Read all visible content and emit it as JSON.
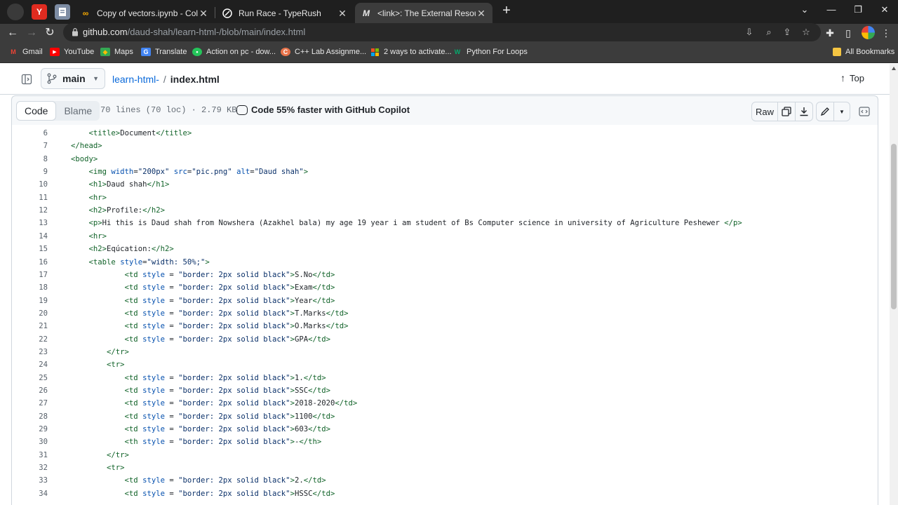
{
  "browser": {
    "pinned_tabs": [
      {
        "icon": "yandex-icon",
        "letter": "Y",
        "color": "#e02b20"
      },
      {
        "icon": "document-icon",
        "letter": "",
        "color": "#7d8ca3"
      }
    ],
    "tabs": [
      {
        "title": "Copy of vectors.ipynb - Colabora",
        "icon": "colab-icon",
        "active": false
      },
      {
        "title": "Run Race - TypeRush",
        "icon": "typerush-icon",
        "active": false
      },
      {
        "title": "<link>: The External Resource Lin",
        "icon": "mdn-icon",
        "active": true
      }
    ],
    "url_host": "github.com",
    "url_path": "/daud-shah/learn-html-/blob/main/index.html",
    "bookmarks": [
      {
        "label": "Gmail",
        "icon": "gmail-icon",
        "color": "#ea4335"
      },
      {
        "label": "YouTube",
        "icon": "youtube-icon",
        "color": "#ff0000"
      },
      {
        "label": "Maps",
        "icon": "maps-icon",
        "color": "#34a853"
      },
      {
        "label": "Translate",
        "icon": "translate-icon",
        "color": "#4285f4"
      },
      {
        "label": "Action on pc - dow...",
        "icon": "action-icon",
        "color": "#24c45a"
      },
      {
        "label": "C++ Lab Assignme...",
        "icon": "cpp-icon",
        "color": "#e8734a"
      },
      {
        "label": "2 ways to activate...",
        "icon": "windows-icon",
        "color": "#f25022"
      },
      {
        "label": "Python For Loops",
        "icon": "w3-icon",
        "color": "#04aa6d"
      }
    ],
    "all_bookmarks": "All Bookmarks"
  },
  "repo": {
    "branch": "main",
    "repo_name": "learn-html-",
    "separator": "/",
    "file_name": "index.html",
    "top_label": "Top"
  },
  "file": {
    "tab_code": "Code",
    "tab_blame": "Blame",
    "meta": "70 lines (70 loc) · 2.79 KB",
    "copilot": "Code 55% faster with GitHub Copilot",
    "raw_label": "Raw"
  },
  "code_lines": [
    {
      "n": "6",
      "t": "        <title>Document</title>"
    },
    {
      "n": "7",
      "t": "    </head>"
    },
    {
      "n": "8",
      "t": "    <body>"
    },
    {
      "n": "9",
      "t": "        <img width=\"200px\" src=\"pic.png\" alt=\"Daud shah\">"
    },
    {
      "n": "10",
      "t": "        <h1>Daud shah</h1>"
    },
    {
      "n": "11",
      "t": "        <hr>"
    },
    {
      "n": "12",
      "t": "        <h2>Profile:</h2>"
    },
    {
      "n": "13",
      "t": "        <p>Hi this is Daud shah from Nowshera (Azakhel bala) my age 19 year i am student of Bs Computer science in university of Agriculture Peshewer </p>"
    },
    {
      "n": "14",
      "t": "        <hr>"
    },
    {
      "n": "15",
      "t": "        <h2>Eqúcation:</h2>"
    },
    {
      "n": "16",
      "t": "        <table style=\"width: 50%;\">"
    },
    {
      "n": "17",
      "t": "                <td style = \"border: 2px solid black\">S.No</td>"
    },
    {
      "n": "18",
      "t": "                <td style = \"border: 2px solid black\">Exam</td>"
    },
    {
      "n": "19",
      "t": "                <td style = \"border: 2px solid black\">Year</td>"
    },
    {
      "n": "20",
      "t": "                <td style = \"border: 2px solid black\">T.Marks</td>"
    },
    {
      "n": "21",
      "t": "                <td style = \"border: 2px solid black\">O.Marks</td>"
    },
    {
      "n": "22",
      "t": "                <td style = \"border: 2px solid black\">GPA</td>"
    },
    {
      "n": "23",
      "t": "            </tr>"
    },
    {
      "n": "24",
      "t": "            <tr>"
    },
    {
      "n": "25",
      "t": "                <td style = \"border: 2px solid black\">1.</td>"
    },
    {
      "n": "26",
      "t": "                <td style = \"border: 2px solid black\">SSC</td>"
    },
    {
      "n": "27",
      "t": "                <td style = \"border: 2px solid black\">2018-2020</td>"
    },
    {
      "n": "28",
      "t": "                <td style = \"border: 2px solid black\">1100</td>"
    },
    {
      "n": "29",
      "t": "                <td style = \"border: 2px solid black\">603</td>"
    },
    {
      "n": "30",
      "t": "                <th style = \"border: 2px solid black\">-</th>"
    },
    {
      "n": "31",
      "t": "            </tr>"
    },
    {
      "n": "32",
      "t": "            <tr>"
    },
    {
      "n": "33",
      "t": "                <td style = \"border: 2px solid black\">2.</td>"
    },
    {
      "n": "34",
      "t": "                <td style = \"border: 2px solid black\">HSSC</td>"
    }
  ],
  "colors": {
    "tag": "#116329",
    "attr": "#0550ae",
    "string": "#0a3069",
    "link": "#0969da"
  }
}
